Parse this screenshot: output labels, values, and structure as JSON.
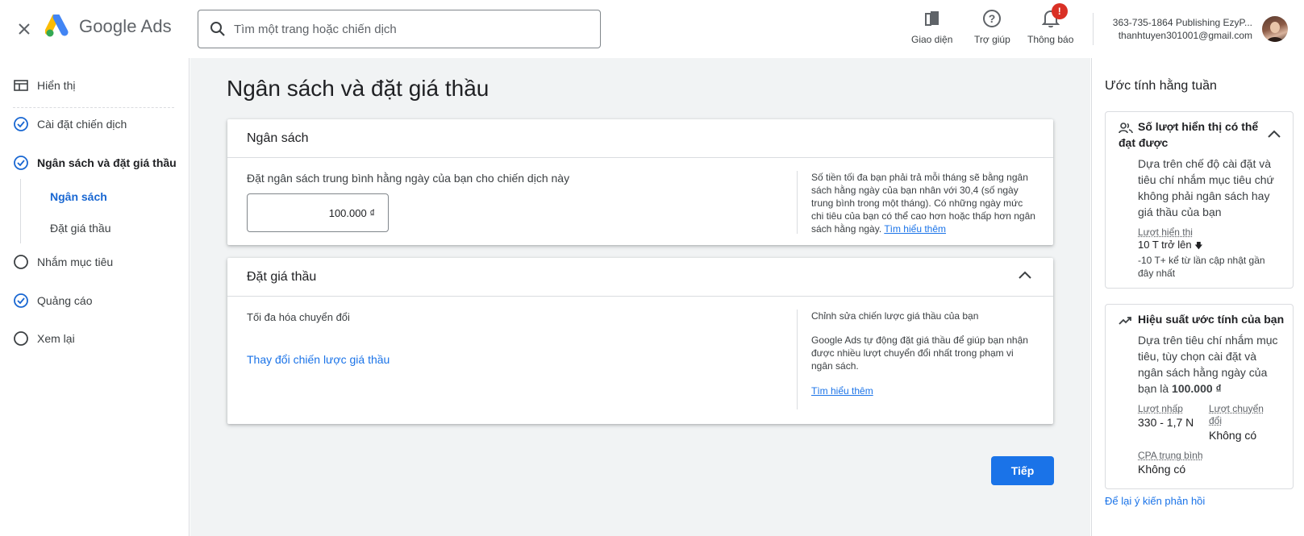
{
  "header": {
    "close_icon": "close-icon",
    "logo_text": "Google Ads",
    "search_placeholder": "Tìm một trang hoặc chiến dịch",
    "tools": [
      {
        "label": "Giao diện",
        "icon": "appearance-icon"
      },
      {
        "label": "Trợ giúp",
        "icon": "help-icon"
      },
      {
        "label": "Thông báo",
        "icon": "bell-icon",
        "badge": "!"
      }
    ],
    "account_name": "363-735-1864 Publishing EzyP...",
    "account_email": "thanhtuyen301001@gmail.com"
  },
  "nav": {
    "items": [
      {
        "label": "Hiển thị",
        "icon": "layout-icon"
      },
      {
        "label": "Cài đặt chiến dịch",
        "icon": "check-circle-icon"
      },
      {
        "label": "Ngân sách và đặt giá thầu",
        "icon": "check-circle-icon"
      },
      {
        "label": "Nhắm mục tiêu",
        "icon": "empty-circle-icon"
      },
      {
        "label": "Quảng cáo",
        "icon": "check-circle-icon"
      },
      {
        "label": "Xem lại",
        "icon": "empty-circle-icon"
      }
    ],
    "sub_items": [
      {
        "label": "Ngân sách"
      },
      {
        "label": "Đặt giá thầu"
      }
    ]
  },
  "main": {
    "title": "Ngân sách và đặt giá thầu",
    "budget": {
      "heading": "Ngân sách",
      "label": "Đặt ngân sách trung bình hằng ngày của bạn cho chiến dịch này",
      "value": "100.000 ₫",
      "note": "Số tiền tối đa bạn phải trả mỗi tháng sẽ bằng ngân sách hằng ngày của bạn nhân với 30,4 (số ngày trung bình trong một tháng). Có những ngày mức chi tiêu của bạn có thể cao hơn hoặc thấp hơn ngân sách hằng ngày.",
      "learn_more": "Tìm hiểu thêm"
    },
    "bidding": {
      "heading": "Đặt giá thầu",
      "strategy": "Tối đa hóa chuyển đổi",
      "change_link": "Thay đổi chiến lược giá thầu",
      "note_title": "Chỉnh sửa chiến lược giá thầu của bạn",
      "note": "Google Ads tự động đặt giá thầu để giúp bạn nhận được nhiều lượt chuyển đổi nhất trong phạm vi ngân sách.",
      "learn_more": "Tìm hiểu thêm"
    },
    "next_button": "Tiếp"
  },
  "right": {
    "title": "Ước tính hằng tuần",
    "impressions_card": {
      "title": "Số lượt hiển thị có thể đạt được",
      "desc": "Dựa trên chế độ cài đặt và tiêu chí nhắm mục tiêu chứ không phải ngân sách hay giá thầu của bạn",
      "label": "Lượt hiển thị",
      "value": "10 T trở lên",
      "change": "-10 T+ kể từ lần cập nhật gần đây nhất"
    },
    "performance_card": {
      "title": "Hiệu suất ước tính của bạn",
      "desc_prefix": "Dựa trên tiêu chí nhắm mục tiêu, tùy chọn cài đặt và ngân sách hằng ngày của bạn là",
      "desc_amount": "100.000 ₫",
      "clicks_label": "Lượt nhấp",
      "clicks_value": "330 - 1,7 N",
      "conv_label": "Lượt chuyển đổi",
      "conv_value": "Không có",
      "cpa_label": "CPA trung bình",
      "cpa_value": "Không có"
    },
    "feedback": "Để lại ý kiến phản hồi"
  },
  "colors": {
    "accent": "#1a73e8",
    "check": "#1967d2",
    "badge": "#d93025",
    "main_bg": "#f1f3f4"
  }
}
